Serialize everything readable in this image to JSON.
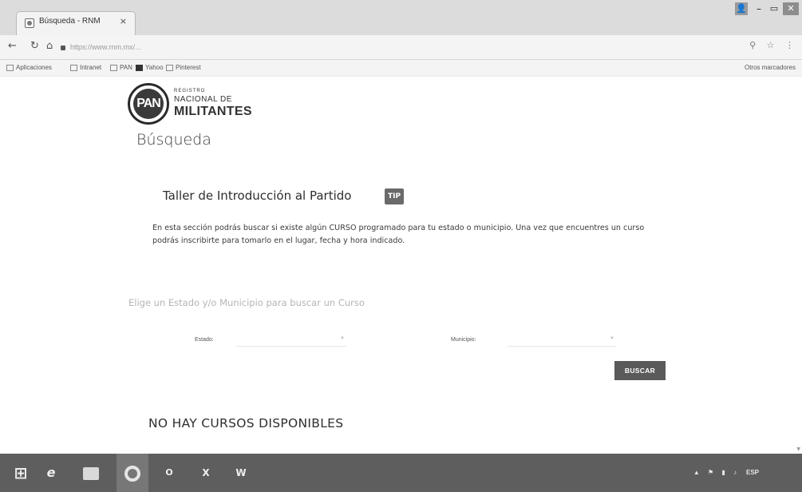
{
  "browser": {
    "tab_title": "Búsqueda - RNM",
    "tab_close": "×",
    "address": "https://www.rnm.mx/...",
    "bookmarks": [
      {
        "label": "Aplicaciones"
      },
      {
        "label": "Intranet"
      },
      {
        "label": "PAN"
      },
      {
        "label": "Yahoo"
      },
      {
        "label": "Pinterest"
      }
    ],
    "bookmarks_right": "Otros marcadores"
  },
  "header": {
    "logo_text": "PAN",
    "brand_line1": "REGISTRO",
    "brand_line2": "NACIONAL DE",
    "brand_line3": "MILITANTES"
  },
  "page": {
    "title": "Búsqueda",
    "section_title": "Taller de Introducción al Partido",
    "tip_label": "TIP",
    "intro_text": "En esta sección podrás buscar si existe algún CURSO programado para tu estado o municipio. Una vez que encuentres un curso podrás inscribirte para tomarlo en el lugar, fecha y hora indicado.",
    "search_prompt": "Elige un Estado y/o Municipio para buscar un Curso",
    "estado_label": "Estado:",
    "estado_value": "",
    "municipio_label": "Municipio:",
    "municipio_value": "",
    "search_button": "BUSCAR",
    "empty_message": "NO HAY CURSOS DISPONIBLES"
  },
  "taskbar": {
    "outlook": "O",
    "excel": "X",
    "word": "W",
    "lang": "ESP",
    "time": "",
    "date": ""
  },
  "colors": {
    "button_bg": "#5a5a5a",
    "tip_bg": "#6a6a6a",
    "taskbar_bg": "#5e5e5e"
  }
}
